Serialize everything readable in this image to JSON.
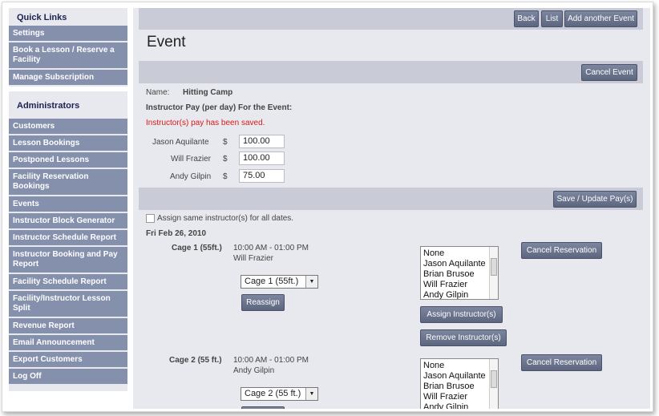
{
  "sidebar": {
    "quick_links_heading": "Quick Links",
    "quick_links": [
      {
        "label": "Settings"
      },
      {
        "label": "Book a Lesson / Reserve a Facility"
      },
      {
        "label": "Manage Subscription"
      }
    ],
    "admin_heading": "Administrators",
    "admin_items": [
      {
        "label": "Customers"
      },
      {
        "label": "Lesson Bookings"
      },
      {
        "label": "Postponed Lessons"
      },
      {
        "label": "Facility Reservation Bookings"
      },
      {
        "label": "Events"
      },
      {
        "label": "Instructor Block Generator"
      },
      {
        "label": "Instructor Schedule Report"
      },
      {
        "label": "Instructor Booking and Pay Report"
      },
      {
        "label": "Facility Schedule Report"
      },
      {
        "label": "Facility/Instructor Lesson Split"
      },
      {
        "label": "Revenue Report"
      },
      {
        "label": "Email Announcement"
      },
      {
        "label": "Export Customers"
      },
      {
        "label": "Log Off"
      }
    ]
  },
  "toolbar": {
    "back": "Back",
    "list": "List",
    "add_event": "Add another Event"
  },
  "page_title": "Event",
  "cancel_event": "Cancel Event",
  "event": {
    "name_label": "Name:",
    "name_value": "Hitting Camp",
    "pay_heading": "Instructor Pay (per day) For the Event:",
    "saved_message": "Instructor(s) pay has been saved.",
    "currency": "$",
    "instructors": [
      {
        "name": "Jason Aquilante",
        "pay": "100.00"
      },
      {
        "name": "Will Frazier",
        "pay": "100.00"
      },
      {
        "name": "Andy Gilpin",
        "pay": "75.00"
      }
    ],
    "save_button": "Save / Update Pay(s)",
    "assign_same_label": "Assign same instructor(s) for all dates.",
    "date": "Fri Feb 26, 2010"
  },
  "instructor_options": [
    "None",
    "Jason Aquilante",
    "Brian Brusoe",
    "Will Frazier",
    "Andy Gilpin"
  ],
  "reservations": [
    {
      "cage": "Cage 1 (55ft.)",
      "time": "10:00 AM - 01:00 PM",
      "instructor": "Will Frazier",
      "select_value": "Cage 1 (55ft.)",
      "reassign": "Reassign",
      "assign": "Assign Instructor(s)",
      "remove": "Remove Instructor(s)",
      "cancel": "Cancel Reservation"
    },
    {
      "cage": "Cage 2 (55 ft.)",
      "time": "10:00 AM - 01:00 PM",
      "instructor": "Andy Gilpin",
      "select_value": "Cage 2 (55 ft.)",
      "cancel": "Cancel Reservation"
    }
  ]
}
